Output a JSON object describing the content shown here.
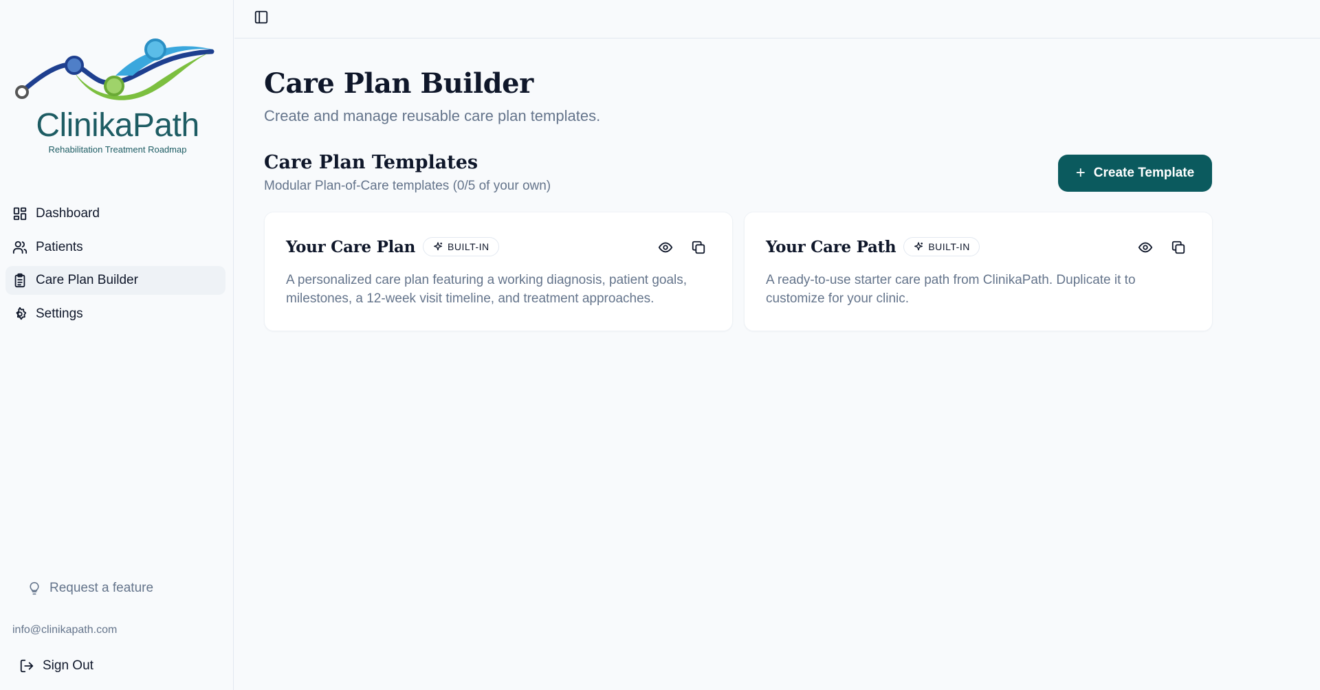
{
  "brand": {
    "name": "ClinikaPath",
    "tagline": "Rehabilitation Treatment Roadmap",
    "colors": {
      "primary": "#0b5a5e",
      "logo_text": "#1d5c63"
    }
  },
  "sidebar": {
    "items": [
      {
        "label": "Dashboard",
        "icon": "dashboard-icon",
        "active": false
      },
      {
        "label": "Patients",
        "icon": "users-icon",
        "active": false
      },
      {
        "label": "Care Plan Builder",
        "icon": "clipboard-icon",
        "active": true
      },
      {
        "label": "Settings",
        "icon": "gear-icon",
        "active": false
      }
    ],
    "request_feature": "Request a feature",
    "email": "info@clinikapath.com",
    "sign_out": "Sign Out"
  },
  "topbar": {
    "toggle_icon": "panel-left-icon"
  },
  "main": {
    "title": "Care Plan Builder",
    "subtitle": "Create and manage reusable care plan templates.",
    "section": {
      "title": "Care Plan Templates",
      "subtitle": "Modular Plan-of-Care templates (0/5 of your own)",
      "create_button": "Create Template"
    },
    "templates": [
      {
        "title": "Your Care Plan",
        "badge": "BUILT-IN",
        "description": "A personalized care plan featuring a working diagnosis, patient goals, milestones, a 12-week visit timeline, and treatment approaches."
      },
      {
        "title": "Your Care Path",
        "badge": "BUILT-IN",
        "description": "A ready-to-use starter care path from ClinikaPath. Duplicate it to customize for your clinic."
      }
    ]
  }
}
